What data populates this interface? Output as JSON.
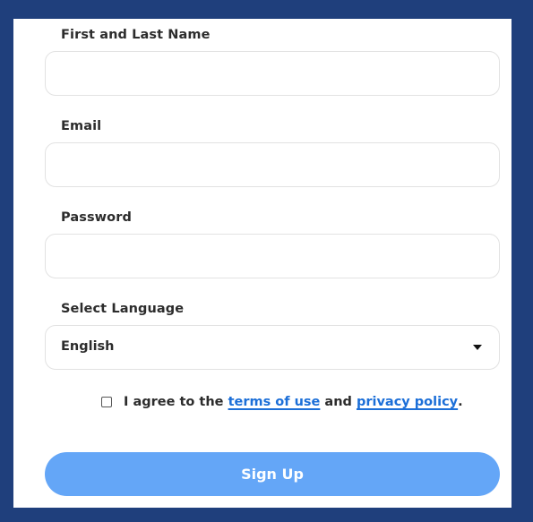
{
  "form": {
    "fields": [
      {
        "label": "First and Last Name",
        "value": "",
        "placeholder": ""
      },
      {
        "label": "Email",
        "value": "",
        "placeholder": ""
      },
      {
        "label": "Password",
        "value": "",
        "placeholder": ""
      }
    ],
    "language": {
      "label": "Select Language",
      "selected": "English"
    },
    "agreement": {
      "prefix": "I agree to the ",
      "terms_link": "terms of use",
      "middle": " and ",
      "privacy_link": "privacy policy",
      "suffix": "."
    },
    "submit_label": "Sign Up"
  },
  "colors": {
    "background": "#1f3f7c",
    "panel": "#ffffff",
    "link": "#1c6fd8",
    "button": "#64a6f7",
    "button_text": "#ffffff"
  }
}
